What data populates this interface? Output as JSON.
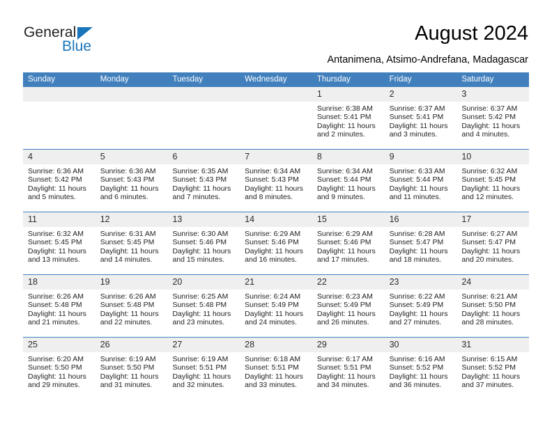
{
  "brand": {
    "name_part1": "General",
    "name_part2": "Blue",
    "triangle_icon": "triangle-icon",
    "color_dark": "#231f20",
    "color_blue": "#1b75bb"
  },
  "header": {
    "title": "August 2024",
    "subtitle": "Antanimena, Atsimo-Andrefana, Madagascar"
  },
  "theme": {
    "header_blue": "#4180bd",
    "daynum_band": "#efefef",
    "text": "#222222"
  },
  "calendar": {
    "weekday_headers": [
      "Sunday",
      "Monday",
      "Tuesday",
      "Wednesday",
      "Thursday",
      "Friday",
      "Saturday"
    ],
    "weeks": [
      {
        "daynums": [
          "",
          "",
          "",
          "",
          "1",
          "2",
          "3"
        ],
        "cells": [
          {
            "empty": true,
            "lines": []
          },
          {
            "empty": true,
            "lines": []
          },
          {
            "empty": true,
            "lines": []
          },
          {
            "empty": true,
            "lines": []
          },
          {
            "empty": false,
            "lines": [
              "Sunrise: 6:38 AM",
              "Sunset: 5:41 PM",
              "Daylight: 11 hours",
              "and 2 minutes."
            ]
          },
          {
            "empty": false,
            "lines": [
              "Sunrise: 6:37 AM",
              "Sunset: 5:41 PM",
              "Daylight: 11 hours",
              "and 3 minutes."
            ]
          },
          {
            "empty": false,
            "lines": [
              "Sunrise: 6:37 AM",
              "Sunset: 5:42 PM",
              "Daylight: 11 hours",
              "and 4 minutes."
            ]
          }
        ]
      },
      {
        "daynums": [
          "4",
          "5",
          "6",
          "7",
          "8",
          "9",
          "10"
        ],
        "cells": [
          {
            "empty": false,
            "lines": [
              "Sunrise: 6:36 AM",
              "Sunset: 5:42 PM",
              "Daylight: 11 hours",
              "and 5 minutes."
            ]
          },
          {
            "empty": false,
            "lines": [
              "Sunrise: 6:36 AM",
              "Sunset: 5:43 PM",
              "Daylight: 11 hours",
              "and 6 minutes."
            ]
          },
          {
            "empty": false,
            "lines": [
              "Sunrise: 6:35 AM",
              "Sunset: 5:43 PM",
              "Daylight: 11 hours",
              "and 7 minutes."
            ]
          },
          {
            "empty": false,
            "lines": [
              "Sunrise: 6:34 AM",
              "Sunset: 5:43 PM",
              "Daylight: 11 hours",
              "and 8 minutes."
            ]
          },
          {
            "empty": false,
            "lines": [
              "Sunrise: 6:34 AM",
              "Sunset: 5:44 PM",
              "Daylight: 11 hours",
              "and 9 minutes."
            ]
          },
          {
            "empty": false,
            "lines": [
              "Sunrise: 6:33 AM",
              "Sunset: 5:44 PM",
              "Daylight: 11 hours",
              "and 11 minutes."
            ]
          },
          {
            "empty": false,
            "lines": [
              "Sunrise: 6:32 AM",
              "Sunset: 5:45 PM",
              "Daylight: 11 hours",
              "and 12 minutes."
            ]
          }
        ]
      },
      {
        "daynums": [
          "11",
          "12",
          "13",
          "14",
          "15",
          "16",
          "17"
        ],
        "cells": [
          {
            "empty": false,
            "lines": [
              "Sunrise: 6:32 AM",
              "Sunset: 5:45 PM",
              "Daylight: 11 hours",
              "and 13 minutes."
            ]
          },
          {
            "empty": false,
            "lines": [
              "Sunrise: 6:31 AM",
              "Sunset: 5:45 PM",
              "Daylight: 11 hours",
              "and 14 minutes."
            ]
          },
          {
            "empty": false,
            "lines": [
              "Sunrise: 6:30 AM",
              "Sunset: 5:46 PM",
              "Daylight: 11 hours",
              "and 15 minutes."
            ]
          },
          {
            "empty": false,
            "lines": [
              "Sunrise: 6:29 AM",
              "Sunset: 5:46 PM",
              "Daylight: 11 hours",
              "and 16 minutes."
            ]
          },
          {
            "empty": false,
            "lines": [
              "Sunrise: 6:29 AM",
              "Sunset: 5:46 PM",
              "Daylight: 11 hours",
              "and 17 minutes."
            ]
          },
          {
            "empty": false,
            "lines": [
              "Sunrise: 6:28 AM",
              "Sunset: 5:47 PM",
              "Daylight: 11 hours",
              "and 18 minutes."
            ]
          },
          {
            "empty": false,
            "lines": [
              "Sunrise: 6:27 AM",
              "Sunset: 5:47 PM",
              "Daylight: 11 hours",
              "and 20 minutes."
            ]
          }
        ]
      },
      {
        "daynums": [
          "18",
          "19",
          "20",
          "21",
          "22",
          "23",
          "24"
        ],
        "cells": [
          {
            "empty": false,
            "lines": [
              "Sunrise: 6:26 AM",
              "Sunset: 5:48 PM",
              "Daylight: 11 hours",
              "and 21 minutes."
            ]
          },
          {
            "empty": false,
            "lines": [
              "Sunrise: 6:26 AM",
              "Sunset: 5:48 PM",
              "Daylight: 11 hours",
              "and 22 minutes."
            ]
          },
          {
            "empty": false,
            "lines": [
              "Sunrise: 6:25 AM",
              "Sunset: 5:48 PM",
              "Daylight: 11 hours",
              "and 23 minutes."
            ]
          },
          {
            "empty": false,
            "lines": [
              "Sunrise: 6:24 AM",
              "Sunset: 5:49 PM",
              "Daylight: 11 hours",
              "and 24 minutes."
            ]
          },
          {
            "empty": false,
            "lines": [
              "Sunrise: 6:23 AM",
              "Sunset: 5:49 PM",
              "Daylight: 11 hours",
              "and 26 minutes."
            ]
          },
          {
            "empty": false,
            "lines": [
              "Sunrise: 6:22 AM",
              "Sunset: 5:49 PM",
              "Daylight: 11 hours",
              "and 27 minutes."
            ]
          },
          {
            "empty": false,
            "lines": [
              "Sunrise: 6:21 AM",
              "Sunset: 5:50 PM",
              "Daylight: 11 hours",
              "and 28 minutes."
            ]
          }
        ]
      },
      {
        "daynums": [
          "25",
          "26",
          "27",
          "28",
          "29",
          "30",
          "31"
        ],
        "cells": [
          {
            "empty": false,
            "lines": [
              "Sunrise: 6:20 AM",
              "Sunset: 5:50 PM",
              "Daylight: 11 hours",
              "and 29 minutes."
            ]
          },
          {
            "empty": false,
            "lines": [
              "Sunrise: 6:19 AM",
              "Sunset: 5:50 PM",
              "Daylight: 11 hours",
              "and 31 minutes."
            ]
          },
          {
            "empty": false,
            "lines": [
              "Sunrise: 6:19 AM",
              "Sunset: 5:51 PM",
              "Daylight: 11 hours",
              "and 32 minutes."
            ]
          },
          {
            "empty": false,
            "lines": [
              "Sunrise: 6:18 AM",
              "Sunset: 5:51 PM",
              "Daylight: 11 hours",
              "and 33 minutes."
            ]
          },
          {
            "empty": false,
            "lines": [
              "Sunrise: 6:17 AM",
              "Sunset: 5:51 PM",
              "Daylight: 11 hours",
              "and 34 minutes."
            ]
          },
          {
            "empty": false,
            "lines": [
              "Sunrise: 6:16 AM",
              "Sunset: 5:52 PM",
              "Daylight: 11 hours",
              "and 36 minutes."
            ]
          },
          {
            "empty": false,
            "lines": [
              "Sunrise: 6:15 AM",
              "Sunset: 5:52 PM",
              "Daylight: 11 hours",
              "and 37 minutes."
            ]
          }
        ]
      }
    ]
  }
}
